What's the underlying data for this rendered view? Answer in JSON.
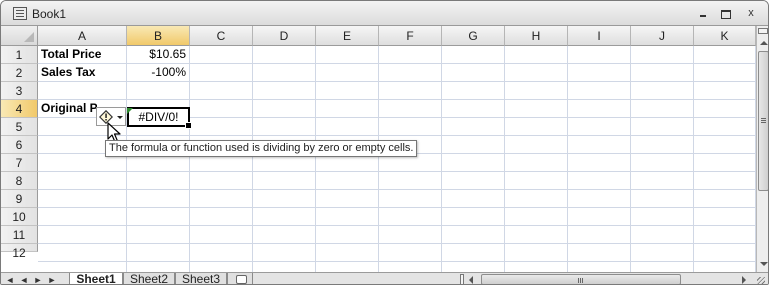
{
  "window": {
    "title": "Book1",
    "controls": {
      "minimize": "-",
      "restore": "□",
      "close": "x"
    }
  },
  "columns": [
    "A",
    "B",
    "C",
    "D",
    "E",
    "F",
    "G",
    "H",
    "I",
    "J",
    "K"
  ],
  "rows": [
    "1",
    "2",
    "3",
    "4",
    "5",
    "6",
    "7",
    "8",
    "9",
    "10",
    "11",
    "12"
  ],
  "cells": {
    "A1": "Total Price",
    "B1": "$10.65",
    "A2": "Sales Tax",
    "B2": "-100%",
    "A4": "Original P",
    "B4": "#DIV/0!"
  },
  "active_cell": "B4",
  "error_smart_tag": {
    "icon": "error-warning-icon",
    "dropdown": "chevron-down-icon"
  },
  "tooltip": "The formula or function used is dividing by zero or empty cells.",
  "sheet_tabs": [
    {
      "label": "Sheet1",
      "active": true
    },
    {
      "label": "Sheet2",
      "active": false
    },
    {
      "label": "Sheet3",
      "active": false
    }
  ],
  "tab_nav": {
    "first": "◄",
    "prev": "◄",
    "next": "►",
    "last": "►"
  },
  "colors": {
    "gridline": "#d0d7e5",
    "active_header": "#f1c96a",
    "error_indicator": "#2e8b2e"
  }
}
